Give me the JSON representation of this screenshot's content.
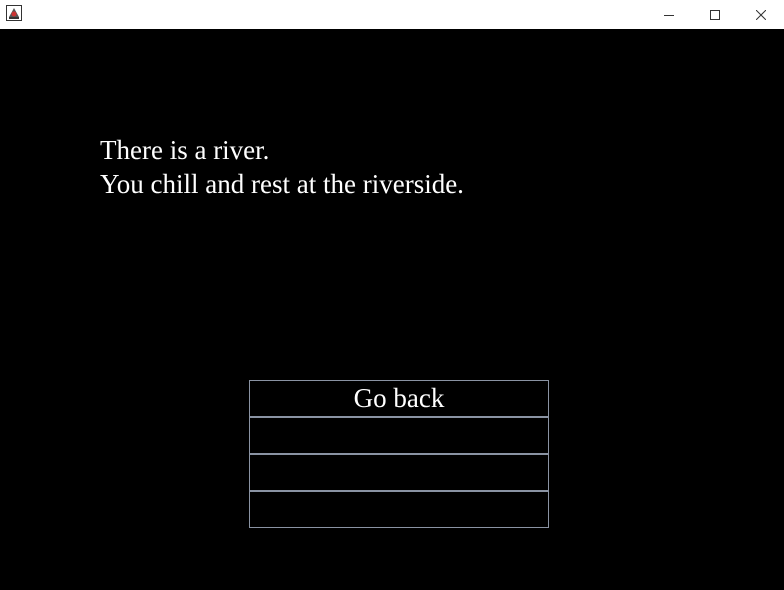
{
  "window": {
    "app_icon": "java-app-icon",
    "controls": {
      "minimize": "minimize-icon",
      "maximize": "maximize-icon",
      "close": "close-icon"
    }
  },
  "story": {
    "lines": [
      "There is a river.",
      "You chill and rest at the riverside."
    ]
  },
  "choices": [
    "Go back",
    "",
    "",
    ""
  ],
  "colors": {
    "background": "#000000",
    "text": "#ffffff",
    "choice_border": "#8a93a3",
    "titlebar": "#ffffff"
  }
}
